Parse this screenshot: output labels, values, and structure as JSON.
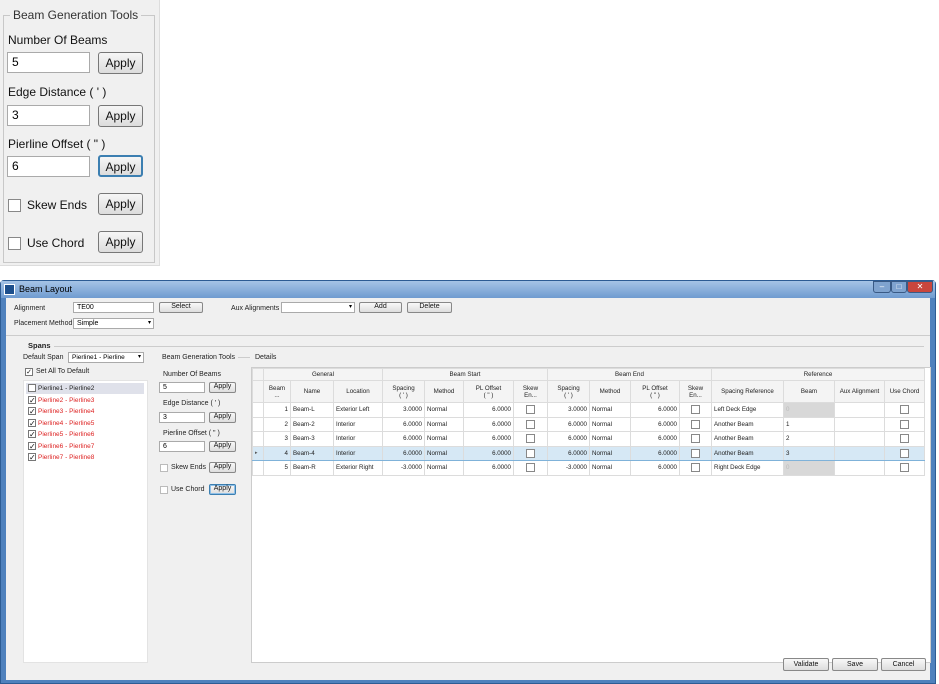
{
  "tool_panel": {
    "title": "Beam Generation Tools",
    "number_of_beams": {
      "label": "Number Of Beams",
      "value": "5"
    },
    "edge_distance": {
      "label": "Edge Distance ( ' )",
      "value": "3"
    },
    "pierline_offset": {
      "label": "Pierline Offset ( \" )",
      "value": "6"
    },
    "skew_ends": {
      "label": "Skew Ends",
      "checked": false
    },
    "use_chord": {
      "label": "Use Chord",
      "checked": false
    },
    "apply_label": "Apply"
  },
  "window": {
    "title": "Beam Layout",
    "controls": {
      "minimize": "–",
      "maximize": "□",
      "close": "✕"
    },
    "alignment_label": "Alignment",
    "alignment_value": "TE00",
    "select_label": "Select",
    "aux_alignments_label": "Aux Alignments",
    "aux_alignments_value": "",
    "add_label": "Add",
    "delete_label": "Delete",
    "placement_method_label": "Placement Method",
    "placement_method_value": "Simple",
    "spans_title": "Spans",
    "default_span_label": "Default Span",
    "default_span_value": "Pierline1 - Pierline",
    "set_all_default_label": "Set All To Default",
    "spans": [
      {
        "label": "Pierline1 - Pierline2",
        "checked": false
      },
      {
        "label": "Pierline2 - Pierline3",
        "checked": true
      },
      {
        "label": "Pierline3 - Pierline4",
        "checked": true
      },
      {
        "label": "Pierline4 - Pierline5",
        "checked": true
      },
      {
        "label": "Pierline5 - Pierline6",
        "checked": true
      },
      {
        "label": "Pierline6 - Pierline7",
        "checked": true
      },
      {
        "label": "Pierline7 - Pierline8",
        "checked": true
      }
    ],
    "bgt": {
      "title": "Beam Generation Tools",
      "nb_label": "Number Of Beams",
      "nb_value": "5",
      "ed_label": "Edge Distance ( ' )",
      "ed_value": "3",
      "po_label": "Pierline Offset ( \" )",
      "po_value": "6",
      "skew_label": "Skew Ends",
      "chord_label": "Use Chord",
      "apply": "Apply"
    },
    "details_title": "Details",
    "group_headers": [
      "General",
      "Beam Start",
      "Beam End",
      "Reference"
    ],
    "columns": [
      "Beam ...",
      "Name",
      "Location",
      "Spacing\n( ' )",
      "Method",
      "PL Offset\n( \" )",
      "Skew En...",
      "Spacing\n( ' )",
      "Method",
      "PL Offset\n( \" )",
      "Skew En...",
      "Spacing Reference",
      "Beam",
      "Aux Alignment",
      "Use Chord"
    ],
    "rows": [
      {
        "num": "1",
        "name": "Beam-L",
        "location": "Exterior Left",
        "s_spacing": "3.0000",
        "s_method": "Normal",
        "s_pl": "6.0000",
        "e_spacing": "3.0000",
        "e_method": "Normal",
        "e_pl": "6.0000",
        "ref": "Left Deck Edge",
        "beam": "0",
        "beam_disabled": true,
        "aux": "",
        "selected": false
      },
      {
        "num": "2",
        "name": "Beam-2",
        "location": "Interior",
        "s_spacing": "6.0000",
        "s_method": "Normal",
        "s_pl": "6.0000",
        "e_spacing": "6.0000",
        "e_method": "Normal",
        "e_pl": "6.0000",
        "ref": "Another Beam",
        "beam": "1",
        "beam_disabled": false,
        "aux": "",
        "selected": false
      },
      {
        "num": "3",
        "name": "Beam-3",
        "location": "Interior",
        "s_spacing": "6.0000",
        "s_method": "Normal",
        "s_pl": "6.0000",
        "e_spacing": "6.0000",
        "e_method": "Normal",
        "e_pl": "6.0000",
        "ref": "Another Beam",
        "beam": "2",
        "beam_disabled": false,
        "aux": "",
        "selected": false
      },
      {
        "num": "4",
        "name": "Beam-4",
        "location": "Interior",
        "s_spacing": "6.0000",
        "s_method": "Normal",
        "s_pl": "6.0000",
        "e_spacing": "6.0000",
        "e_method": "Normal",
        "e_pl": "6.0000",
        "ref": "Another Beam",
        "beam": "3",
        "beam_disabled": false,
        "aux": "",
        "selected": true
      },
      {
        "num": "5",
        "name": "Beam-R",
        "location": "Exterior Right",
        "s_spacing": "-3.0000",
        "s_method": "Normal",
        "s_pl": "6.0000",
        "e_spacing": "-3.0000",
        "e_method": "Normal",
        "e_pl": "6.0000",
        "ref": "Right Deck Edge",
        "beam": "0",
        "beam_disabled": true,
        "aux": "",
        "selected": false
      }
    ],
    "validate_label": "Validate",
    "save_label": "Save",
    "cancel_label": "Cancel"
  }
}
